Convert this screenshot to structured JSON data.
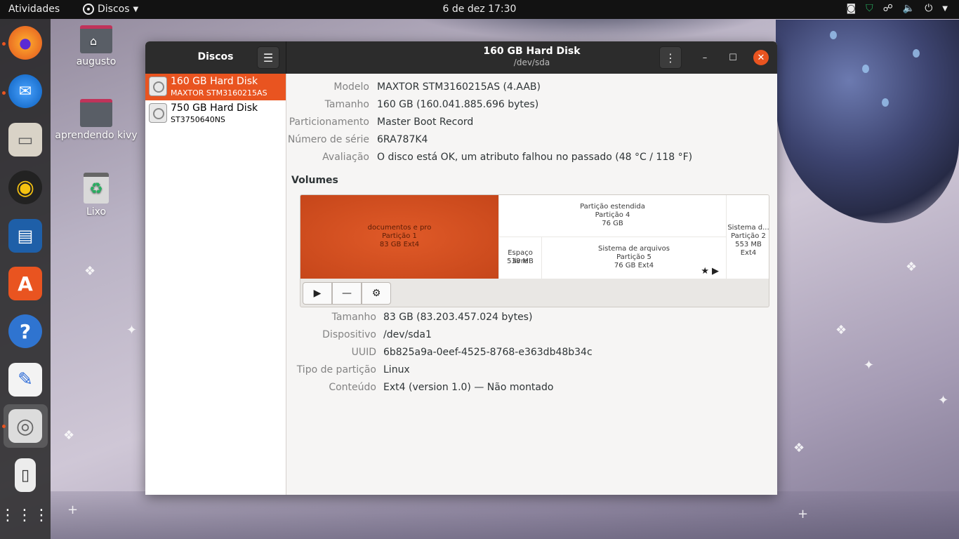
{
  "topbar": {
    "activities": "Atividades",
    "app_name": "Discos",
    "clock": "6 de dez  17:30"
  },
  "desktop": {
    "icons": [
      {
        "label": "augusto"
      },
      {
        "label": "aprendendo kivy"
      },
      {
        "label": "Lixo"
      }
    ]
  },
  "window": {
    "sidebar_title": "Discos",
    "title": "160 GB Hard Disk",
    "subtitle": "/dev/sda"
  },
  "drives": [
    {
      "name": "160 GB Hard Disk",
      "model": "MAXTOR STM3160215AS",
      "selected": true
    },
    {
      "name": "750 GB Hard Disk",
      "model": "ST3750640NS",
      "selected": false
    }
  ],
  "disk_info": [
    {
      "label": "Modelo",
      "value": "MAXTOR STM3160215AS (4.AAB)"
    },
    {
      "label": "Tamanho",
      "value": "160 GB (160.041.885.696 bytes)"
    },
    {
      "label": "Particionamento",
      "value": "Master Boot Record"
    },
    {
      "label": "Número de série",
      "value": "6RA787K4"
    },
    {
      "label": "Avaliação",
      "value": "O disco está OK, um atributo falhou no passado (48 °C / 118 °F)"
    }
  ],
  "volumes": {
    "heading": "Volumes",
    "segments": {
      "p1": [
        "documentos e pro",
        "Partição 1",
        "83 GB Ext4"
      ],
      "ext": [
        "Partição estendida",
        "Partição 4",
        "76 GB"
      ],
      "free": [
        "Espaço livre",
        "538 MB"
      ],
      "p5": [
        "Sistema de arquivos",
        "Partição 5",
        "76 GB Ext4"
      ],
      "p2": [
        "Sistema d...",
        "Partição 2",
        "553 MB Ext4"
      ]
    }
  },
  "volume_info": [
    {
      "label": "Tamanho",
      "value": "83 GB (83.203.457.024 bytes)"
    },
    {
      "label": "Dispositivo",
      "value": "/dev/sda1"
    },
    {
      "label": "UUID",
      "value": "6b825a9a-0eef-4525-8768-e363db48b34c"
    },
    {
      "label": "Tipo de partição",
      "value": "Linux"
    },
    {
      "label": "Conteúdo",
      "value": "Ext4 (version 1.0) — Não montado"
    }
  ],
  "colors": {
    "accent": "#e95420",
    "headerbar": "#2c2c2c",
    "topbar": "#121212"
  }
}
